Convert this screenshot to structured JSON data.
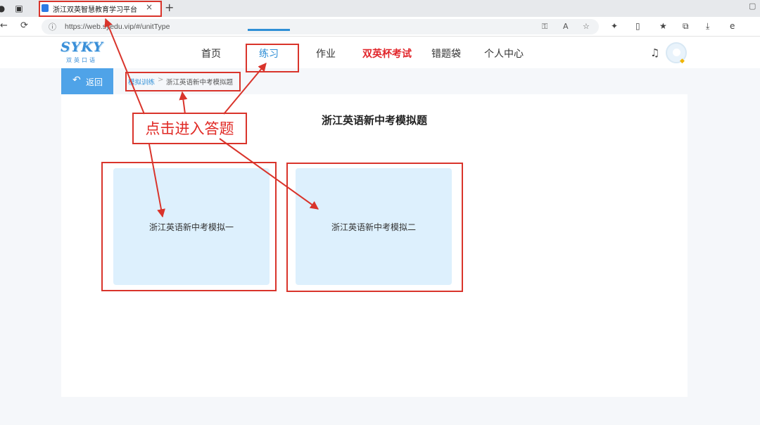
{
  "browser": {
    "tab_title": "浙江双英智慧教育学习平台",
    "tab_close": "×",
    "new_tab": "+",
    "url": "https://web.syedu.vip/#/unitType"
  },
  "icons": {
    "back": "←",
    "refresh": "⟳",
    "lock": "🔒",
    "key": "⚿",
    "read_aloud": "A",
    "favorite": "☆",
    "extensions": "✦",
    "split": "▯",
    "favorites": "★",
    "collections": "⧉",
    "downloads": "⤓",
    "edge": "e",
    "bell": "🔔",
    "tab_actions": "▣",
    "window_restore": "▢"
  },
  "site": {
    "logo_main": "SYKY",
    "logo_sub": "双英口语",
    "nav": [
      "首页",
      "练习",
      "作业",
      "双英杯考试",
      "错题袋",
      "个人中心"
    ],
    "active_nav": "练习",
    "back_label": "返回"
  },
  "breadcrumb": {
    "parent": "模拟训练",
    "separator": ">",
    "current": "浙江英语新中考模拟题"
  },
  "page": {
    "title": "浙江英语新中考模拟题",
    "cards": [
      "浙江英语新中考模拟一",
      "浙江英语新中考模拟二"
    ]
  },
  "annotation": {
    "callout": "点击进入答题",
    "color": "#d9342b"
  },
  "colors": {
    "accent": "#2f8fd6",
    "hot_nav": "#e1252a",
    "card_bg": "#ddf0fd",
    "back_button": "#4fa3e8"
  }
}
